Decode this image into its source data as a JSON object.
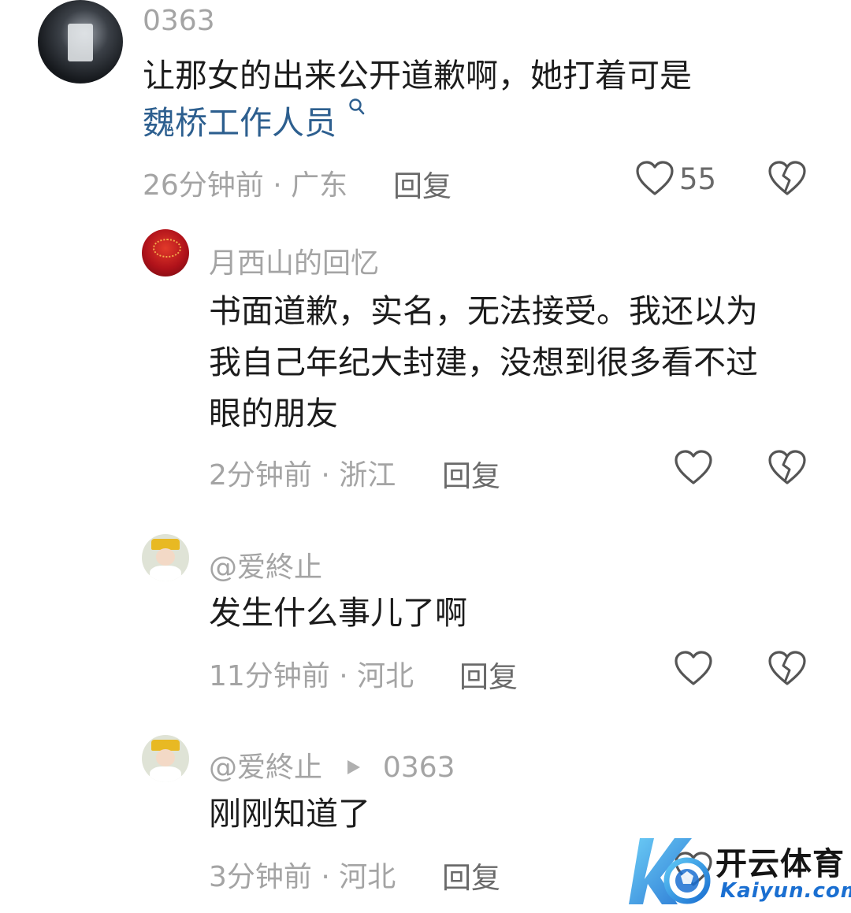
{
  "comments": [
    {
      "username": "0363",
      "content_line1": "让那女的出来公开道歉啊，她打着可是",
      "content_link": "魏桥工作人员",
      "meta": "26分钟前 · 广东",
      "reply": "回复",
      "likes": "55"
    },
    {
      "username": "月西山的回忆",
      "content_line1": "书面道歉，实名，无法接受。我还以为",
      "content_line2": "我自己年纪大封建，没想到很多看不过",
      "content_line3": "眼的朋友",
      "meta": "2分钟前 · 浙江",
      "reply": "回复"
    },
    {
      "username": "@爱終止",
      "content_line1": "发生什么事儿了啊",
      "meta": "11分钟前 · 河北",
      "reply": "回复"
    },
    {
      "username": "@爱終止",
      "reply_to": "0363",
      "content_line1": "刚刚知道了",
      "meta": "3分钟前 · 河北",
      "reply": "回复"
    }
  ],
  "icons": {
    "like": "heart-outline-icon",
    "dislike": "broken-heart-icon",
    "search": "search-icon",
    "reply_arrow": "triangle-right-icon"
  },
  "watermark": {
    "brand": "开云体育",
    "domain": "Kaiyun.com"
  },
  "colors": {
    "link": "#2d5f8f",
    "username": "#a4a4a4",
    "content": "#1c1c1c",
    "watermark_blue": "#2b8fe0"
  }
}
